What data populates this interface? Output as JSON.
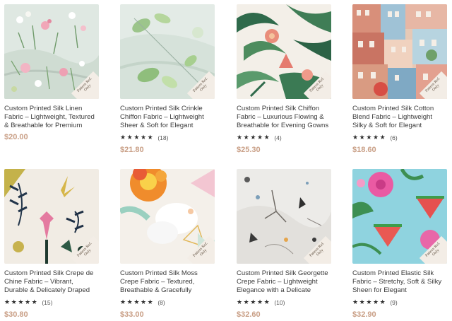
{
  "products": [
    {
      "title": "Custom Printed Silk Linen Fabric – Lightweight, Textured & Breathable for Premium",
      "stars": "★★★★★",
      "count": "",
      "price": "$20.00",
      "tag_line1": "Pattern Ref.",
      "tag_line2": "Only",
      "pattern": "floral-meadow"
    },
    {
      "title": "Custom Printed Silk Crinkle Chiffon Fabric – Lightweight Sheer & Soft for Elegant",
      "stars": "★★★★★",
      "count": "(18)",
      "price": "$21.80",
      "tag_line1": "Pattern Ref.",
      "tag_line2": "Only",
      "pattern": "leaf-watercolor"
    },
    {
      "title": "Custom Printed Silk Chiffon Fabric – Luxurious Flowing & Breathable for Evening Gowns",
      "stars": "★★★★★",
      "count": "(4)",
      "price": "$25.30",
      "tag_line1": "Pattern Ref.",
      "tag_line2": "Only",
      "pattern": "tropical-palm"
    },
    {
      "title": "Custom Printed Silk Cotton Blend Fabric – Lightweight Silky & Soft for Elegant",
      "stars": "★★★★★",
      "count": "(6)",
      "price": "$18.60",
      "tag_line1": "Pattern Ref.",
      "tag_line2": "Only",
      "pattern": "houses"
    },
    {
      "title": "Custom Printed Silk Crepe de Chine Fabric – Vibrant, Durable & Delicately Draped",
      "stars": "★★★★★",
      "count": "(15)",
      "price": "$30.80",
      "tag_line1": "Pattern Ref.",
      "tag_line2": "Only",
      "pattern": "boho-leaves"
    },
    {
      "title": "Custom Printed Silk Moss Crepe Fabric – Textured, Breathable & Gracefully",
      "stars": "★★★★★",
      "count": "(8)",
      "price": "$33.00",
      "tag_line1": "Pattern Ref.",
      "tag_line2": "Only",
      "pattern": "big-flower"
    },
    {
      "title": "Custom Printed Silk Georgette Crepe Fabric – Lightweight Elegance with a Delicate",
      "stars": "★★★★★",
      "count": "(10)",
      "price": "$32.60",
      "tag_line1": "Pattern Ref.",
      "tag_line2": "Only",
      "pattern": "bird-sketch"
    },
    {
      "title": "Custom Printed Elastic Silk Fabric – Stretchy, Soft & Silky Sheen for Elegant",
      "stars": "★★★★★",
      "count": "(9)",
      "price": "$32.90",
      "tag_line1": "Pattern Ref.",
      "tag_line2": "Only",
      "pattern": "watermelon-hibiscus"
    }
  ],
  "colors": {
    "price": "#c99f86",
    "tag_bg": "#f3ede6",
    "stars": "#2f2f2f"
  }
}
